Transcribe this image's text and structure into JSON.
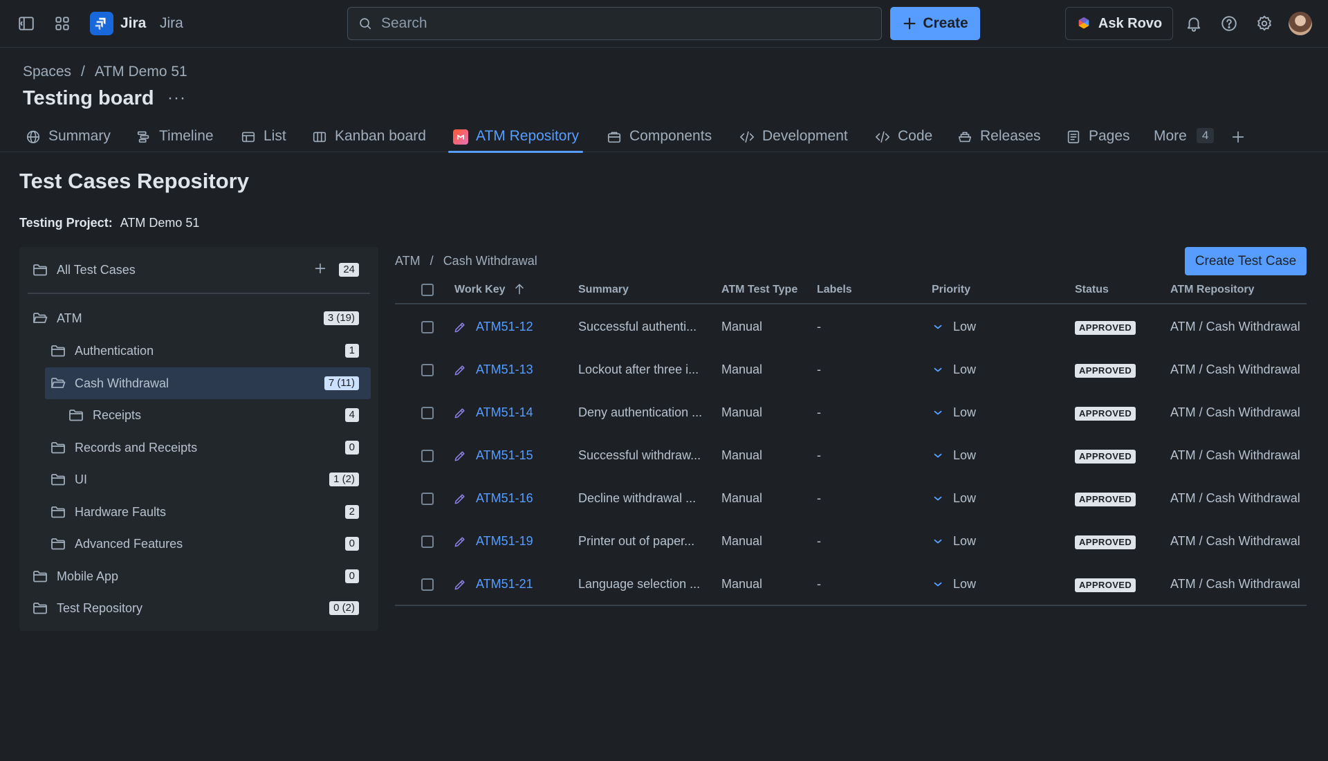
{
  "topbar": {
    "brand": "Jira",
    "brand_secondary": "Jira",
    "search_placeholder": "Search",
    "create_label": "Create",
    "rovo_label": "Ask Rovo",
    "icons": [
      "sidebar-toggle-icon",
      "app-switcher-icon",
      "jira-logo-icon",
      "search-icon",
      "plus-icon",
      "rovo-icon",
      "bell-icon",
      "help-icon",
      "gear-icon",
      "avatar"
    ]
  },
  "breadcrumb": [
    "Spaces",
    "/",
    "ATM Demo 51"
  ],
  "page_title": "Testing board",
  "title_more": "···",
  "tabs": [
    {
      "label": "Summary",
      "icon": "globe-icon"
    },
    {
      "label": "Timeline",
      "icon": "timeline-icon"
    },
    {
      "label": "List",
      "icon": "list-icon"
    },
    {
      "label": "Kanban board",
      "icon": "board-icon"
    },
    {
      "label": "ATM Repository",
      "icon": "atm-app-icon",
      "active": true
    },
    {
      "label": "Components",
      "icon": "components-icon"
    },
    {
      "label": "Development",
      "icon": "development-icon"
    },
    {
      "label": "Code",
      "icon": "code-icon"
    },
    {
      "label": "Releases",
      "icon": "releases-icon"
    },
    {
      "label": "Pages",
      "icon": "pages-icon"
    },
    {
      "label": "More",
      "icon": null,
      "count": "4"
    }
  ],
  "repo": {
    "title": "Test Cases Repository",
    "project_label": "Testing Project:",
    "project_value": "ATM Demo 51"
  },
  "tree": [
    {
      "label": "All Test Cases",
      "count": "24"
    },
    {
      "label": "ATM",
      "count": "3 (19)"
    },
    {
      "label": "Authentication",
      "count": "1"
    },
    {
      "label": "Cash Withdrawal",
      "count": "7 (11)",
      "selected": true
    },
    {
      "label": "Receipts",
      "count": "4"
    },
    {
      "label": "Records and Receipts",
      "count": "0"
    },
    {
      "label": "UI",
      "count": "1 (2)"
    },
    {
      "label": "Hardware Faults",
      "count": "2"
    },
    {
      "label": "Advanced Features",
      "count": "0"
    },
    {
      "label": "Mobile App",
      "count": "0"
    },
    {
      "label": "Test Repository",
      "count": "0 (2)"
    }
  ],
  "table": {
    "breadcrumb": [
      "ATM",
      "/",
      "Cash Withdrawal"
    ],
    "create_button": "Create Test Case",
    "columns": [
      "Work Key",
      "Summary",
      "ATM Test Type",
      "Labels",
      "Priority",
      "Status",
      "ATM Repository"
    ],
    "rows": [
      {
        "key": "ATM51-12",
        "summary": "Successful authenti...",
        "type": "Manual",
        "labels": "-",
        "priority": "Low",
        "status": "APPROVED",
        "repo": "ATM / Cash Withdrawal"
      },
      {
        "key": "ATM51-13",
        "summary": "Lockout after three i...",
        "type": "Manual",
        "labels": "-",
        "priority": "Low",
        "status": "APPROVED",
        "repo": "ATM / Cash Withdrawal"
      },
      {
        "key": "ATM51-14",
        "summary": "Deny authentication ...",
        "type": "Manual",
        "labels": "-",
        "priority": "Low",
        "status": "APPROVED",
        "repo": "ATM / Cash Withdrawal"
      },
      {
        "key": "ATM51-15",
        "summary": "Successful withdraw...",
        "type": "Manual",
        "labels": "-",
        "priority": "Low",
        "status": "APPROVED",
        "repo": "ATM / Cash Withdrawal"
      },
      {
        "key": "ATM51-16",
        "summary": "Decline withdrawal ...",
        "type": "Manual",
        "labels": "-",
        "priority": "Low",
        "status": "APPROVED",
        "repo": "ATM / Cash Withdrawal"
      },
      {
        "key": "ATM51-19",
        "summary": "Printer out of paper...",
        "type": "Manual",
        "labels": "-",
        "priority": "Low",
        "status": "APPROVED",
        "repo": "ATM / Cash Withdrawal"
      },
      {
        "key": "ATM51-21",
        "summary": "Language selection ...",
        "type": "Manual",
        "labels": "-",
        "priority": "Low",
        "status": "APPROVED",
        "repo": "ATM / Cash Withdrawal"
      }
    ]
  },
  "colors": {
    "background": "#1d2125",
    "accent": "#579dff",
    "selected_row": "#2b3a4f",
    "badge_bg": "#dee4ea"
  }
}
